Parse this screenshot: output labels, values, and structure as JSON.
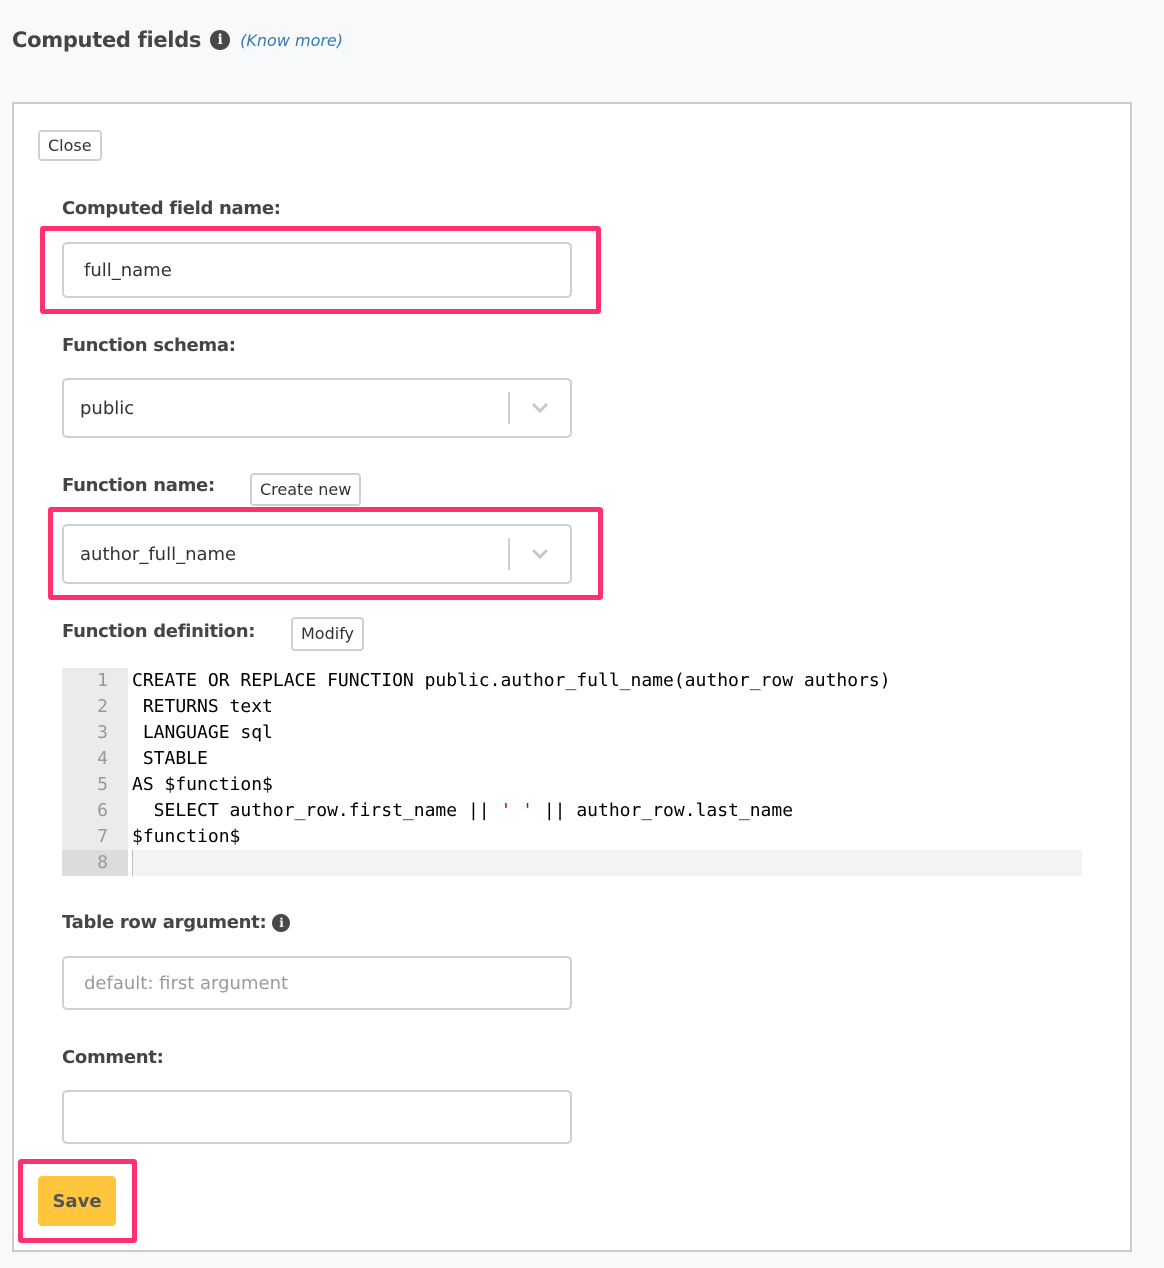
{
  "header": {
    "title": "Computed fields",
    "info_icon": "info-circle-icon",
    "know_more": "(Know more)"
  },
  "panel": {
    "close_label": "Close",
    "computed_field_name": {
      "label": "Computed field name:",
      "value": "full_name"
    },
    "function_schema": {
      "label": "Function schema:",
      "selected": "public"
    },
    "function_name": {
      "label": "Function name:",
      "create_new_label": "Create new",
      "selected": "author_full_name"
    },
    "function_definition": {
      "label": "Function definition:",
      "modify_label": "Modify",
      "lines": [
        {
          "n": "1",
          "code": "CREATE OR REPLACE FUNCTION public.author_full_name(author_row authors)"
        },
        {
          "n": "2",
          "code": " RETURNS text"
        },
        {
          "n": "3",
          "code": " LANGUAGE sql"
        },
        {
          "n": "4",
          "code": " STABLE"
        },
        {
          "n": "5",
          "code": "AS $function$"
        },
        {
          "n": "6",
          "code_pre": "  SELECT author_row.first_name || ",
          "code_str": "' '",
          "code_post": " || author_row.last_name"
        },
        {
          "n": "7",
          "code": "$function$"
        },
        {
          "n": "8",
          "code": ""
        }
      ]
    },
    "table_row_argument": {
      "label": "Table row argument:",
      "placeholder": "default: first argument",
      "value": ""
    },
    "comment": {
      "label": "Comment:",
      "value": ""
    },
    "save_label": "Save"
  },
  "colors": {
    "highlight": "#ff306e",
    "save_button": "#fec53d",
    "link": "#337ab7"
  }
}
